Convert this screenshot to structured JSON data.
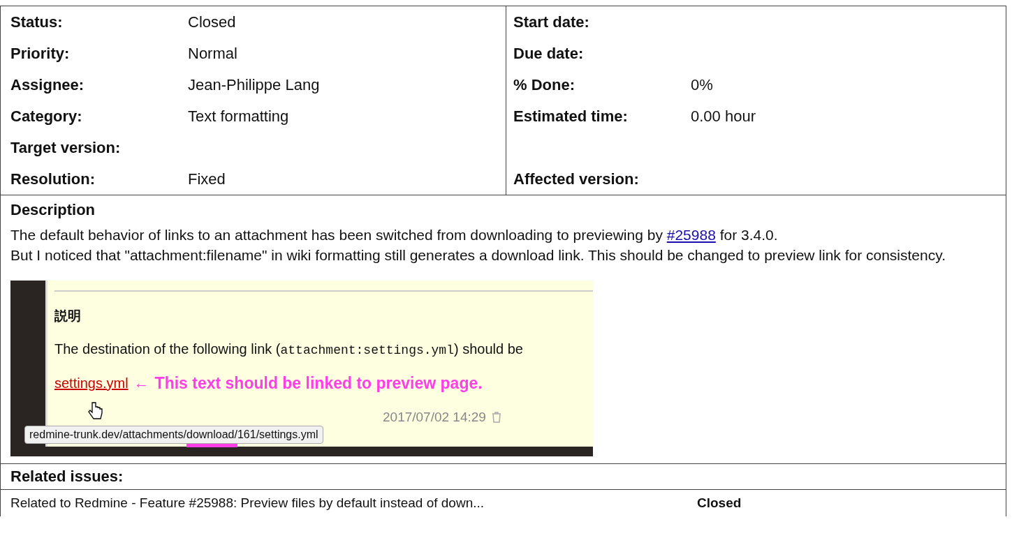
{
  "attributes": [
    {
      "left": {
        "label": "Status:",
        "value": "Closed"
      },
      "right": {
        "label": "Start date:"
      }
    },
    {
      "left": {
        "label": "Priority:",
        "value": "Normal"
      },
      "right": {
        "label": "Due date:"
      }
    },
    {
      "left": {
        "label": "Assignee:",
        "value": "Jean-Philippe Lang"
      },
      "right": {
        "label": "% Done:",
        "value": "0%"
      }
    },
    {
      "left": {
        "label": "Category:",
        "value": "Text formatting"
      },
      "right": {
        "label": "Estimated time:",
        "value": "0.00 hour"
      }
    },
    {
      "left": {
        "label": "Target version:"
      }
    },
    {
      "left": {
        "label": "Resolution:",
        "value": "Fixed"
      },
      "right": {
        "label": "Affected version:"
      }
    }
  ],
  "description": {
    "title": "Description",
    "lines": [
      {
        "before": "The default behavior of links to an attachment has been switched from downloading to previewing by",
        "link": "#25988",
        "after": "for 3.4.0."
      },
      {
        "before": "But I noticed that \"attachment:filename\" in wiki formatting still generates a download link. This should be changed to preview link for consistency."
      }
    ],
    "screenshot": {
      "heading": "説明",
      "sentence_before": "The destination of the following link (",
      "code": "attachment:settings.yml",
      "sentence_after": ") should be",
      "link": "settings.yml",
      "arrow": "←",
      "note": "This text should be linked to preview page.",
      "tooltip_before": "redmine-trunk.dev/attachments/",
      "tooltip_highlight": "download/",
      "tooltip_after": "161/settings.yml",
      "date": "2017/07/02 14:29"
    }
  },
  "related": {
    "title": "Related issues:",
    "rows": [
      {
        "text": "Related to Redmine - Feature #25988: Preview files by default instead of down...",
        "status": "Closed"
      }
    ]
  }
}
